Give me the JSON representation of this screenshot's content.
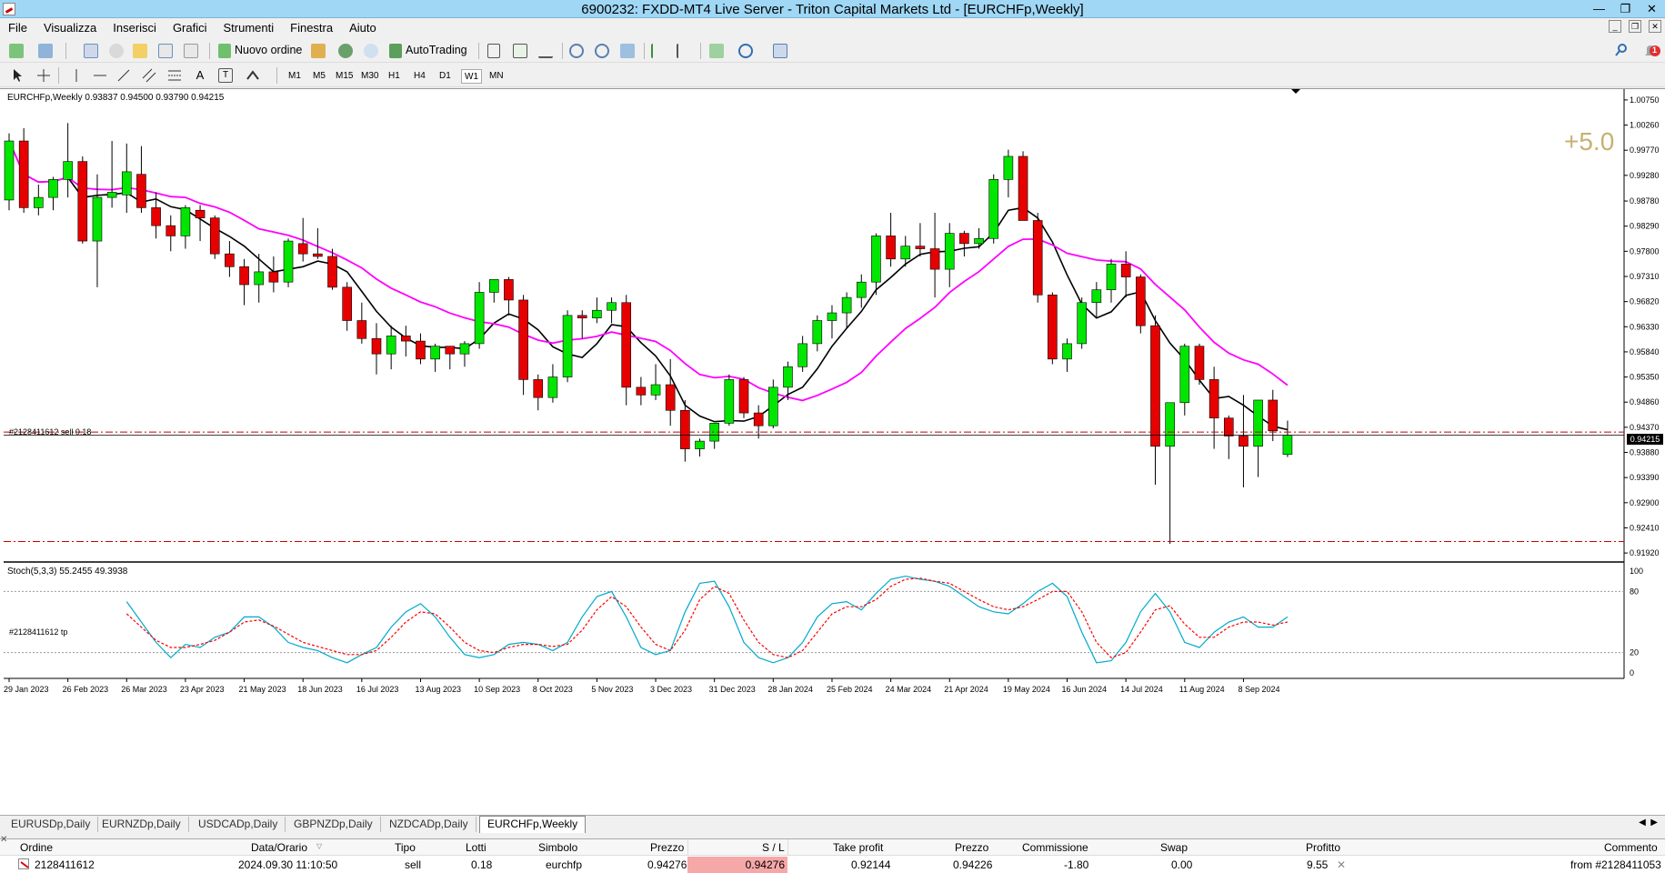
{
  "window": {
    "title": "6900232: FXDD-MT4 Live Server - Triton Capital Markets Ltd - [EURCHFp,Weekly]",
    "controls": [
      "—",
      "❐",
      "✕"
    ]
  },
  "menu": {
    "items": [
      "File",
      "Visualizza",
      "Inserisci",
      "Grafici",
      "Strumenti",
      "Finestra",
      "Aiuto"
    ],
    "mdi_controls": [
      "_",
      "❐",
      "✕"
    ]
  },
  "toolbar": {
    "new_order_label": "Nuovo ordine",
    "autotrading_label": "AutoTrading",
    "notification_count": "1"
  },
  "timeframes": {
    "items": [
      "M1",
      "M5",
      "M15",
      "M30",
      "H1",
      "H4",
      "D1",
      "W1",
      "MN"
    ],
    "active": "W1"
  },
  "chart": {
    "header": "EURCHFp,Weekly  0.93837 0.94500 0.93790 0.94215",
    "profit_overlay": "+5.0",
    "sell_line_label": "#2128411612 sell 0.18",
    "tp_line_label": "#2128411612 tp",
    "current_price_label": "0.94215",
    "stoch_header": "Stoch(5,3,3) 55.2455 49.3938",
    "colors": {
      "bull": "#00e600",
      "bear": "#e60000",
      "ma_fast": "#000000",
      "ma_slow": "#ff00ff",
      "stoch_main": "#00aacc",
      "stoch_signal": "#ff0000",
      "order_line": "#cc0000"
    }
  },
  "chart_data": {
    "type": "candlestick",
    "symbol": "EURCHFp",
    "timeframe": "Weekly",
    "ylim": [
      0.9178,
      1.0089
    ],
    "price_ticks": [
      "1.00750",
      "1.00260",
      "0.99770",
      "0.99280",
      "0.98780",
      "0.98290",
      "0.97800",
      "0.97310",
      "0.96820",
      "0.96330",
      "0.95840",
      "0.95350",
      "0.94860",
      "0.94370",
      "0.93880",
      "0.93390",
      "0.92900",
      "0.92410",
      "0.91920"
    ],
    "date_ticks": [
      "29 Jan 2023",
      "26 Feb 2023",
      "26 Mar 2023",
      "23 Apr 2023",
      "21 May 2023",
      "18 Jun 2023",
      "16 Jul 2023",
      "13 Aug 2023",
      "10 Sep 2023",
      "8 Oct 2023",
      "5 Nov 2023",
      "3 Dec 2023",
      "31 Dec 2023",
      "28 Jan 2024",
      "25 Feb 2024",
      "24 Mar 2024",
      "21 Apr 2024",
      "19 May 2024",
      "16 Jun 2024",
      "14 Jul 2024",
      "11 Aug 2024",
      "8 Sep 2024"
    ],
    "ohlc": [
      [
        0.988,
        1.001,
        0.986,
        0.9995
      ],
      [
        0.9995,
        1.002,
        0.9855,
        0.9865
      ],
      [
        0.9865,
        0.991,
        0.985,
        0.9885
      ],
      [
        0.9885,
        0.9925,
        0.986,
        0.992
      ],
      [
        0.992,
        1.003,
        0.9885,
        0.9955
      ],
      [
        0.9955,
        0.9965,
        0.9795,
        0.98
      ],
      [
        0.98,
        0.993,
        0.971,
        0.9885
      ],
      [
        0.9885,
        0.9995,
        0.9865,
        0.9895
      ],
      [
        0.989,
        0.999,
        0.9855,
        0.9935
      ],
      [
        0.993,
        0.9985,
        0.9855,
        0.9865
      ],
      [
        0.9865,
        0.9895,
        0.9805,
        0.983
      ],
      [
        0.983,
        0.985,
        0.978,
        0.981
      ],
      [
        0.981,
        0.987,
        0.9785,
        0.9865
      ],
      [
        0.986,
        0.987,
        0.98,
        0.9845
      ],
      [
        0.9845,
        0.985,
        0.9765,
        0.9775
      ],
      [
        0.9775,
        0.98,
        0.973,
        0.975
      ],
      [
        0.975,
        0.9765,
        0.9675,
        0.9715
      ],
      [
        0.9715,
        0.9775,
        0.968,
        0.974
      ],
      [
        0.974,
        0.977,
        0.97,
        0.972
      ],
      [
        0.972,
        0.9805,
        0.971,
        0.98
      ],
      [
        0.9795,
        0.9845,
        0.976,
        0.9775
      ],
      [
        0.9775,
        0.9825,
        0.9765,
        0.977
      ],
      [
        0.977,
        0.9785,
        0.9705,
        0.971
      ],
      [
        0.971,
        0.972,
        0.9625,
        0.9645
      ],
      [
        0.9645,
        0.968,
        0.96,
        0.961
      ],
      [
        0.961,
        0.964,
        0.954,
        0.958
      ],
      [
        0.958,
        0.9635,
        0.955,
        0.9615
      ],
      [
        0.9615,
        0.9635,
        0.9575,
        0.9605
      ],
      [
        0.9605,
        0.962,
        0.956,
        0.957
      ],
      [
        0.957,
        0.96,
        0.9545,
        0.9595
      ],
      [
        0.9595,
        0.9595,
        0.955,
        0.958
      ],
      [
        0.958,
        0.9605,
        0.9555,
        0.96
      ],
      [
        0.96,
        0.972,
        0.959,
        0.97
      ],
      [
        0.97,
        0.972,
        0.968,
        0.9725
      ],
      [
        0.9725,
        0.973,
        0.9655,
        0.9685
      ],
      [
        0.9685,
        0.9695,
        0.95,
        0.953
      ],
      [
        0.953,
        0.954,
        0.947,
        0.9495
      ],
      [
        0.9495,
        0.956,
        0.9485,
        0.9535
      ],
      [
        0.9535,
        0.9665,
        0.9525,
        0.9655
      ],
      [
        0.9655,
        0.9665,
        0.961,
        0.965
      ],
      [
        0.965,
        0.969,
        0.964,
        0.9665
      ],
      [
        0.9665,
        0.969,
        0.964,
        0.968
      ],
      [
        0.968,
        0.9695,
        0.948,
        0.9515
      ],
      [
        0.9515,
        0.9535,
        0.948,
        0.95
      ],
      [
        0.95,
        0.956,
        0.949,
        0.952
      ],
      [
        0.952,
        0.957,
        0.944,
        0.947
      ],
      [
        0.947,
        0.949,
        0.937,
        0.9395
      ],
      [
        0.9395,
        0.9415,
        0.938,
        0.941
      ],
      [
        0.941,
        0.9445,
        0.9395,
        0.9445
      ],
      [
        0.9445,
        0.954,
        0.944,
        0.953
      ],
      [
        0.953,
        0.9535,
        0.9455,
        0.9465
      ],
      [
        0.9465,
        0.948,
        0.9415,
        0.944
      ],
      [
        0.944,
        0.953,
        0.9435,
        0.9515
      ],
      [
        0.9515,
        0.9565,
        0.949,
        0.9555
      ],
      [
        0.9555,
        0.9615,
        0.9545,
        0.96
      ],
      [
        0.96,
        0.9655,
        0.9585,
        0.9645
      ],
      [
        0.9645,
        0.9675,
        0.961,
        0.966
      ],
      [
        0.966,
        0.97,
        0.963,
        0.969
      ],
      [
        0.969,
        0.9735,
        0.967,
        0.972
      ],
      [
        0.972,
        0.9815,
        0.9695,
        0.981
      ],
      [
        0.981,
        0.9855,
        0.975,
        0.9765
      ],
      [
        0.9765,
        0.981,
        0.975,
        0.979
      ],
      [
        0.979,
        0.9835,
        0.977,
        0.9785
      ],
      [
        0.9785,
        0.9855,
        0.969,
        0.9745
      ],
      [
        0.9745,
        0.9835,
        0.971,
        0.9815
      ],
      [
        0.9815,
        0.982,
        0.977,
        0.9795
      ],
      [
        0.9795,
        0.9825,
        0.9785,
        0.9805
      ],
      [
        0.9805,
        0.993,
        0.9795,
        0.992
      ],
      [
        0.992,
        0.9978,
        0.9885,
        0.9965
      ],
      [
        0.9965,
        0.9975,
        0.987,
        0.984
      ],
      [
        0.984,
        0.9855,
        0.968,
        0.9695
      ],
      [
        0.9695,
        0.97,
        0.956,
        0.957
      ],
      [
        0.957,
        0.961,
        0.9545,
        0.96
      ],
      [
        0.96,
        0.969,
        0.959,
        0.968
      ],
      [
        0.968,
        0.972,
        0.965,
        0.9705
      ],
      [
        0.9705,
        0.9765,
        0.968,
        0.9755
      ],
      [
        0.9755,
        0.978,
        0.969,
        0.973
      ],
      [
        0.973,
        0.9735,
        0.962,
        0.9635
      ],
      [
        0.9635,
        0.9655,
        0.9325,
        0.94
      ],
      [
        0.94,
        0.9485,
        0.921,
        0.9485
      ],
      [
        0.9485,
        0.96,
        0.946,
        0.9595
      ],
      [
        0.9595,
        0.96,
        0.952,
        0.953
      ],
      [
        0.953,
        0.9555,
        0.9395,
        0.9455
      ],
      [
        0.9455,
        0.946,
        0.9375,
        0.942
      ],
      [
        0.942,
        0.95,
        0.932,
        0.94
      ],
      [
        0.94,
        0.947,
        0.934,
        0.949
      ],
      [
        0.949,
        0.951,
        0.941,
        0.943
      ],
      [
        0.9384,
        0.945,
        0.9379,
        0.94215
      ]
    ],
    "orders": [
      {
        "label": "#2128411612 sell 0.18",
        "price": 0.94276
      },
      {
        "label": "#2128411612 tp",
        "price": 0.92144
      }
    ],
    "stochastic": {
      "levels": [
        20,
        80
      ],
      "ylim": [
        0,
        100
      ],
      "ticks": [
        "100",
        "80",
        "20",
        "0"
      ],
      "main": [
        70,
        50,
        30,
        15,
        28,
        25,
        35,
        40,
        55,
        55,
        45,
        30,
        25,
        22,
        15,
        10,
        18,
        25,
        45,
        60,
        68,
        55,
        35,
        18,
        15,
        18,
        28,
        30,
        28,
        22,
        30,
        55,
        75,
        80,
        55,
        25,
        18,
        22,
        60,
        88,
        90,
        65,
        30,
        15,
        10,
        15,
        30,
        55,
        68,
        70,
        62,
        78,
        92,
        95,
        92,
        90,
        85,
        75,
        65,
        60,
        58,
        68,
        80,
        88,
        75,
        40,
        10,
        12,
        30,
        60,
        78,
        60,
        30,
        25,
        40,
        50,
        55,
        45,
        45,
        55
      ],
      "signal": [
        58,
        45,
        32,
        25,
        25,
        28,
        32,
        40,
        50,
        52,
        46,
        38,
        30,
        26,
        22,
        18,
        18,
        22,
        35,
        50,
        60,
        58,
        45,
        30,
        22,
        20,
        25,
        28,
        28,
        26,
        28,
        42,
        62,
        75,
        65,
        45,
        28,
        22,
        42,
        72,
        85,
        78,
        52,
        30,
        18,
        15,
        22,
        40,
        58,
        65,
        65,
        72,
        85,
        92,
        93,
        90,
        88,
        80,
        72,
        65,
        62,
        65,
        72,
        80,
        80,
        60,
        30,
        15,
        20,
        40,
        62,
        66,
        48,
        35,
        35,
        45,
        50,
        50,
        47,
        50
      ]
    }
  },
  "symbol_tabs": [
    "EURUSDp,Daily",
    "EURNZDp,Daily",
    "USDCADp,Daily",
    "GBPNZDp,Daily",
    "NZDCADp,Daily",
    "EURCHFp,Weekly"
  ],
  "active_tab": "EURCHFp,Weekly",
  "terminal": {
    "columns": [
      "Ordine",
      "Data/Orario",
      "Tipo",
      "Lotti",
      "Simbolo",
      "Prezzo",
      "S / L",
      "Take profit",
      "Prezzo",
      "Commissione",
      "Swap",
      "Profitto",
      "Commento"
    ],
    "row": {
      "order": "2128411612",
      "time": "2024.09.30 11:10:50",
      "type": "sell",
      "lots": "0.18",
      "symbol": "eurchfp",
      "price": "0.94276",
      "sl": "0.94276",
      "tp": "0.92144",
      "current_price": "0.94226",
      "commission": "-1.80",
      "swap": "0.00",
      "profit": "9.55",
      "comment": "from #2128411053"
    }
  }
}
